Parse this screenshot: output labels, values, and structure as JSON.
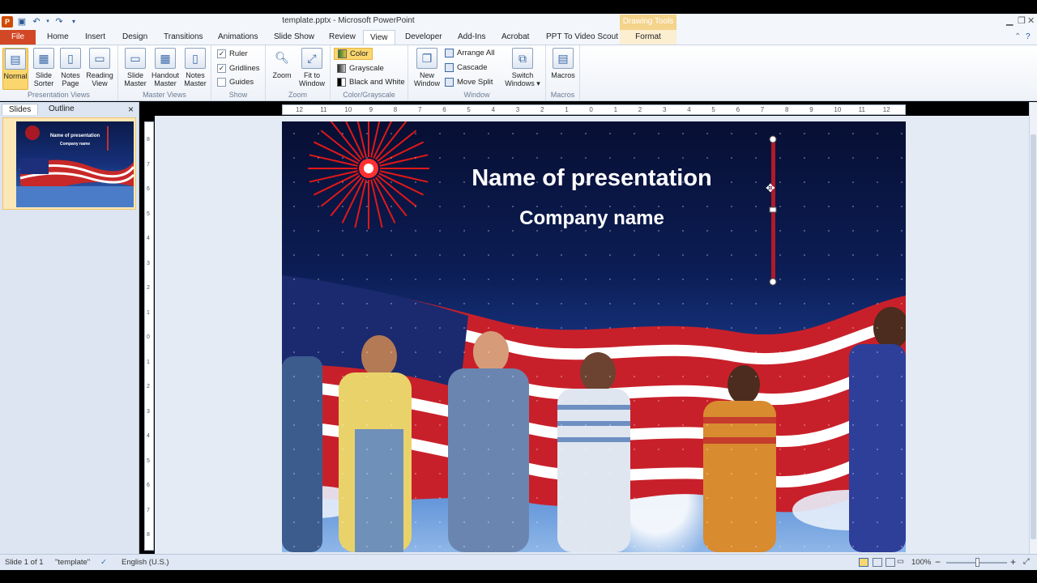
{
  "window": {
    "title": "template.pptx - Microsoft PowerPoint",
    "app_logo": "P",
    "contextual_group": "Drawing Tools",
    "min_icon": "min-icon",
    "restore_icon": "restore-icon",
    "close_icon": "close-icon"
  },
  "tabs": {
    "file": "File",
    "home": "Home",
    "insert": "Insert",
    "design": "Design",
    "transitions": "Transitions",
    "animations": "Animations",
    "slideshow": "Slide Show",
    "review": "Review",
    "view": "View",
    "developer": "Developer",
    "addins": "Add-Ins",
    "acrobat": "Acrobat",
    "ppt_video": "PPT To Video Scout",
    "format": "Format"
  },
  "ribbon": {
    "presentation_views": {
      "label": "Presentation Views",
      "normal": "Normal",
      "slide_sorter_1": "Slide",
      "slide_sorter_2": "Sorter",
      "notes_page_1": "Notes",
      "notes_page_2": "Page",
      "reading_view_1": "Reading",
      "reading_view_2": "View"
    },
    "master_views": {
      "label": "Master Views",
      "slide_master_1": "Slide",
      "slide_master_2": "Master",
      "handout_master_1": "Handout",
      "handout_master_2": "Master",
      "notes_master_1": "Notes",
      "notes_master_2": "Master"
    },
    "show": {
      "label": "Show",
      "ruler": "Ruler",
      "gridlines": "Gridlines",
      "guides": "Guides",
      "ruler_checked": "✓",
      "gridlines_checked": "✓"
    },
    "zoom": {
      "label": "Zoom",
      "zoom": "Zoom",
      "fit_1": "Fit to",
      "fit_2": "Window"
    },
    "color": {
      "label": "Color/Grayscale",
      "color": "Color",
      "grayscale": "Grayscale",
      "bw": "Black and White"
    },
    "window": {
      "label": "Window",
      "new_1": "New",
      "new_2": "Window",
      "arrange_all": "Arrange All",
      "cascade": "Cascade",
      "move_split": "Move Split",
      "switch_1": "Switch",
      "switch_2": "Windows ▾"
    },
    "macros": {
      "label": "Macros",
      "macros": "Macros"
    }
  },
  "panel": {
    "tab_slides": "Slides",
    "tab_outline": "Outline",
    "close": "×",
    "thumb_number": "1",
    "thumb_title": "Name of presentation",
    "thumb_sub": "Company name"
  },
  "slide": {
    "title": "Name of presentation",
    "subtitle": "Company name"
  },
  "ruler": {
    "h_ticks": [
      "12",
      "11",
      "10",
      "9",
      "8",
      "7",
      "6",
      "5",
      "4",
      "3",
      "2",
      "1",
      "0",
      "1",
      "2",
      "3",
      "4",
      "5",
      "6",
      "7",
      "8",
      "9",
      "10",
      "11",
      "12"
    ],
    "v_ticks": [
      "8",
      "7",
      "6",
      "5",
      "4",
      "3",
      "2",
      "1",
      "0",
      "1",
      "2",
      "3",
      "4",
      "5",
      "6",
      "7",
      "8"
    ]
  },
  "status": {
    "slide_of": "Slide 1 of 1",
    "theme": "\"template\"",
    "language": "English (U.S.)",
    "zoom": "100%",
    "zoom_out": "−",
    "zoom_in": "+"
  },
  "colors": {
    "file_tab": "#d24726",
    "active_view_button": "#fbd66e",
    "drawing_tools": "#f4d38a",
    "slide_background": "#0c1d55"
  }
}
